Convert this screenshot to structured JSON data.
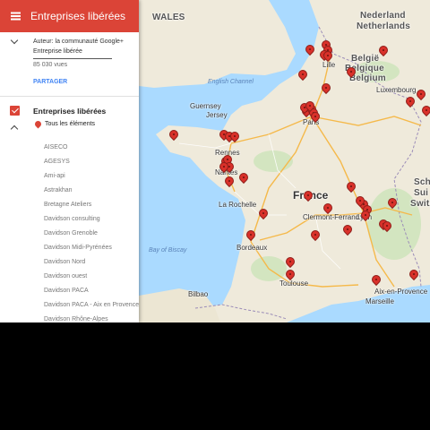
{
  "header": {
    "title": "Entreprises libérées",
    "menu_icon": "hamburger-menu-icon"
  },
  "details": {
    "author": "Auteur: la communauté Google+ Entreprise libérée",
    "views": "85 030 vues",
    "share_label": "PARTAGER"
  },
  "layer": {
    "name": "Entreprises libérées",
    "checked": true,
    "all_items_label": "Tous les éléments",
    "items": [
      "AISECO",
      "AGESYS",
      "Ami-api",
      "Astrakhan",
      "Bretagne Ateliers",
      "Davidson consulting",
      "Davidson Grenoble",
      "Davidson Midi-Pyrénées",
      "Davidson Nord",
      "Davidson ouest",
      "Davidson PACA",
      "Davidson PACA - Aix en Provence",
      "Davidson Rhône-Alpes"
    ]
  },
  "map": {
    "country_label": "France",
    "countries": [
      "WALES",
      "Nederland",
      "Netherlands",
      "België",
      "Belgique",
      "Belgium",
      "Luxembourg",
      "Sch",
      "Sui",
      "Switz"
    ],
    "places": [
      "Guernsey",
      "Jersey",
      "Rennes",
      "Nantes",
      "La Rochelle",
      "Bordeaux",
      "Toulouse",
      "Marseille",
      "Aix-en-Provence",
      "Lyon",
      "Clermont-Ferrand",
      "Lille",
      "Paris",
      "Bilbao"
    ],
    "seas": [
      "English Channel",
      "Bay of Biscay"
    ],
    "marker_count": 46,
    "colors": {
      "accent": "#db4437",
      "marker": "#d9312a",
      "water": "#aadaff",
      "land": "#efeadb",
      "share": "#4285f4"
    }
  }
}
